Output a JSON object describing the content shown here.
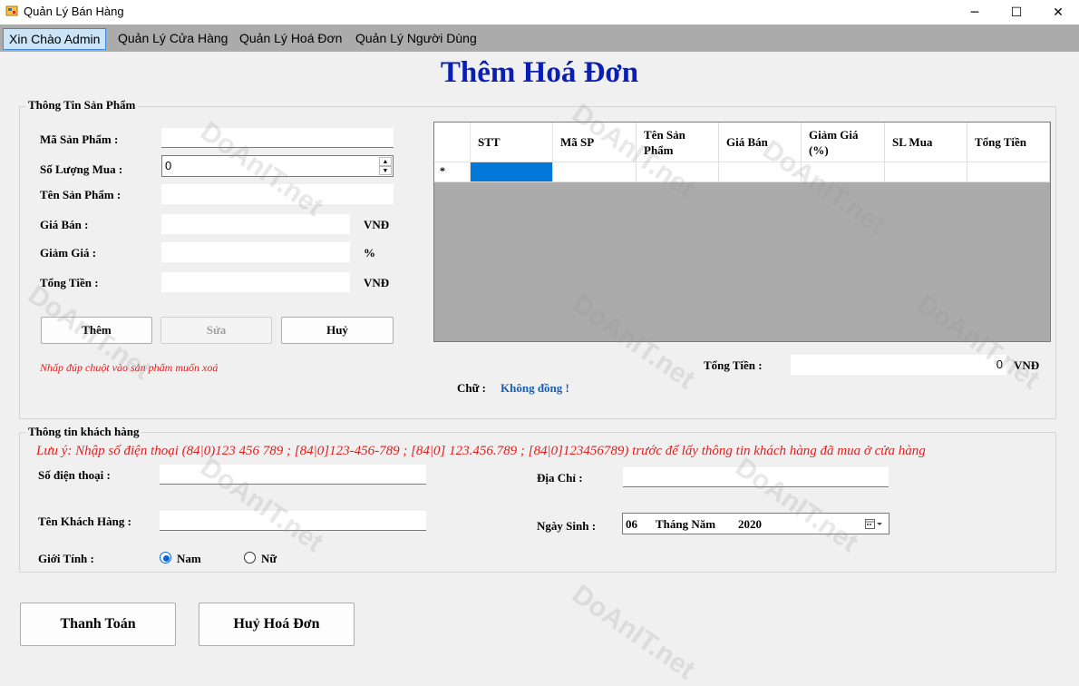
{
  "window": {
    "title": "Quản Lý Bán Hàng",
    "minimize": "─",
    "maximize": "☐",
    "close": "✕"
  },
  "menu": [
    {
      "label": "Xin Chào Admin"
    },
    {
      "label": "Quản Lý Cửa Hàng"
    },
    {
      "label": "Quản Lý Hoá Đơn"
    },
    {
      "label": "Quản Lý Người Dùng"
    }
  ],
  "page_title": "Thêm Hoá Đơn",
  "product": {
    "group_title": "Thông Tin Sản Phẩm",
    "ma_sp_label": "Mã Sản Phẩm :",
    "ma_sp_value": "",
    "so_luong_label": "Số Lượng Mua :",
    "so_luong_value": "0",
    "ten_sp_label": "Tên Sản Phẩm :",
    "ten_sp_value": "",
    "gia_ban_label": "Giá Bán :",
    "gia_ban_value": "",
    "gia_ban_unit": "VNĐ",
    "giam_gia_label": "Giảm Giá  :",
    "giam_gia_value": "",
    "giam_gia_unit": "%",
    "tong_tien_label": "Tổng Tiền :",
    "tong_tien_value": "",
    "tong_tien_unit": "VNĐ",
    "btn_them": "Thêm",
    "btn_sua": "Sửa",
    "btn_huy": "Huỷ",
    "note": "Nhấp đúp chuột vào sản phẩm muốn xoá"
  },
  "grid": {
    "columns": [
      "STT",
      "Mã SP",
      "Tên Sản Phẩm",
      "Giá Bán",
      "Giảm Giá (%)",
      "SL Mua",
      "Tổng Tiền"
    ],
    "new_row_marker": "*"
  },
  "summary": {
    "tong_tien_label": "Tổng Tiền :",
    "tong_tien_value": "0",
    "tong_tien_unit": "VNĐ",
    "chu_label": "Chữ :",
    "chu_value": "Không đồng !"
  },
  "customer": {
    "group_title": "Thông tin khách hàng",
    "note": "Lưu ý: Nhập số điện thoại (84|0)123 456 789  ; [84|0]123-456-789 ; [84|0] 123.456.789 ; [84|0]123456789) trước để lấy thông tin khách hàng đã mua ở cửa hàng",
    "sdt_label": "Số điện thoại :",
    "sdt_value": "",
    "ten_label": "Tên Khách Hàng :",
    "ten_value": "",
    "gioi_tinh_label": "Giới Tính :",
    "nam_label": "Nam",
    "nu_label": "Nữ",
    "dia_chi_label": "Địa Chỉ :",
    "dia_chi_value": "",
    "ngay_sinh_label": "Ngày Sinh :",
    "ngay_sinh_day": "06",
    "ngay_sinh_month": "Tháng Năm",
    "ngay_sinh_year": "2020"
  },
  "actions": {
    "thanh_toan": "Thanh Toán",
    "huy_hoa_don": "Huỷ Hoá Đơn"
  },
  "watermark": "DoAnIT.net",
  "colors": {
    "title": "#0a1eb4",
    "note_red": "#e21d1d",
    "chu_blue": "#1a5fb4",
    "menu_bar": "#ababab",
    "grid_bg": "#ababab",
    "selected_cell": "#0078d7"
  }
}
